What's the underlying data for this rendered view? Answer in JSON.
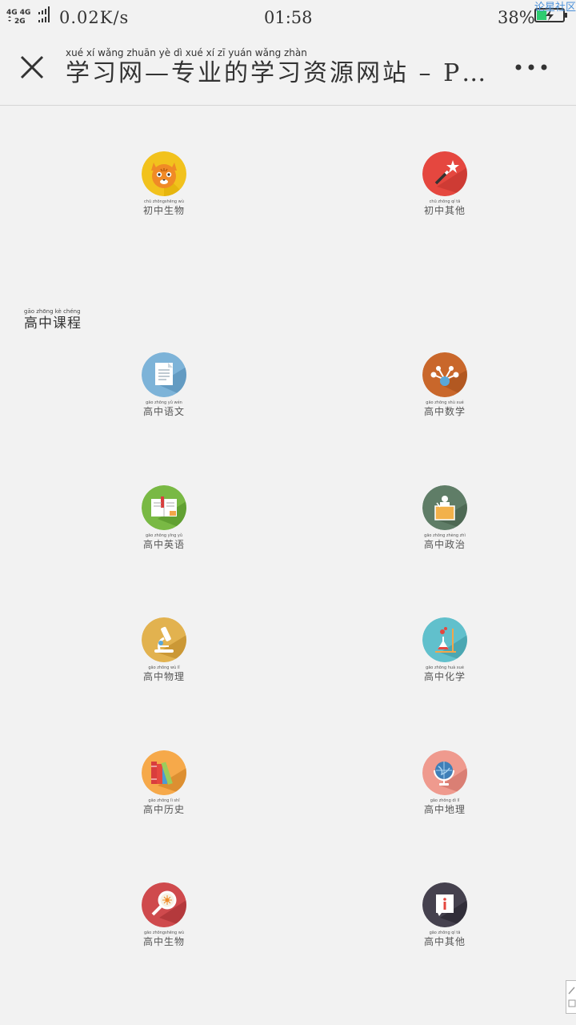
{
  "status_bar": {
    "network_top": "4G 4G",
    "network_bottom": "2G",
    "speed": "0.02K/s",
    "time": "01:58",
    "battery_percent": "38%",
    "battery_level": 0.38,
    "corner_text": "论星社区"
  },
  "header": {
    "title_pinyin": "xué   xí  wǎng     zhuān  yè    dì   xué   xí    zī   yuán wǎng zhàn",
    "title": "学习网—专业的学习资源网站 – P…",
    "close_icon": "close-icon",
    "more_icon": "more-icon"
  },
  "section": {
    "pinyin": "gāo  zhōng  kè  chéng",
    "title": "高中课程"
  },
  "items": [
    {
      "pinyin": "chū zhōngshēng wù",
      "label": "初中生物",
      "icon": "cat-icon",
      "color": "#f2c21d"
    },
    {
      "pinyin": "chū zhōng  qí   tā",
      "label": "初中其他",
      "icon": "magic-wand-icon",
      "color": "#e5473f"
    },
    {
      "pinyin": "gāo zhōng  yǔ  wén",
      "label": "高中语文",
      "icon": "document-icon",
      "color": "#7db3d8"
    },
    {
      "pinyin": "gāo zhōng shù xué",
      "label": "高中数学",
      "icon": "molecule-icon",
      "color": "#c9672b"
    },
    {
      "pinyin": "gāo zhōng yīng  yǔ",
      "label": "高中英语",
      "icon": "book-icon",
      "color": "#79b944"
    },
    {
      "pinyin": "gāo zhōng zhèng zhì",
      "label": "高中政治",
      "icon": "podium-icon",
      "color": "#5f7d67"
    },
    {
      "pinyin": "gāo zhōng  wù   lǐ",
      "label": "高中物理",
      "icon": "microscope-icon",
      "color": "#e2b24f"
    },
    {
      "pinyin": "gāo zhōng huà xué",
      "label": "高中化学",
      "icon": "flask-icon",
      "color": "#61c0cc"
    },
    {
      "pinyin": "gāo zhōng   lì   shǐ",
      "label": "高中历史",
      "icon": "books-icon",
      "color": "#f6a94a"
    },
    {
      "pinyin": "gāo zhōng  dì    lǐ",
      "label": "高中地理",
      "icon": "globe-icon",
      "color": "#ef9a8e"
    },
    {
      "pinyin": "gāo zhōngshēng wù",
      "label": "高中生物",
      "icon": "magnifier-icon",
      "color": "#cf4a4d"
    },
    {
      "pinyin": "gāo zhōng  qí   tā",
      "label": "高中其他",
      "icon": "info-book-icon",
      "color": "#45414e"
    }
  ]
}
